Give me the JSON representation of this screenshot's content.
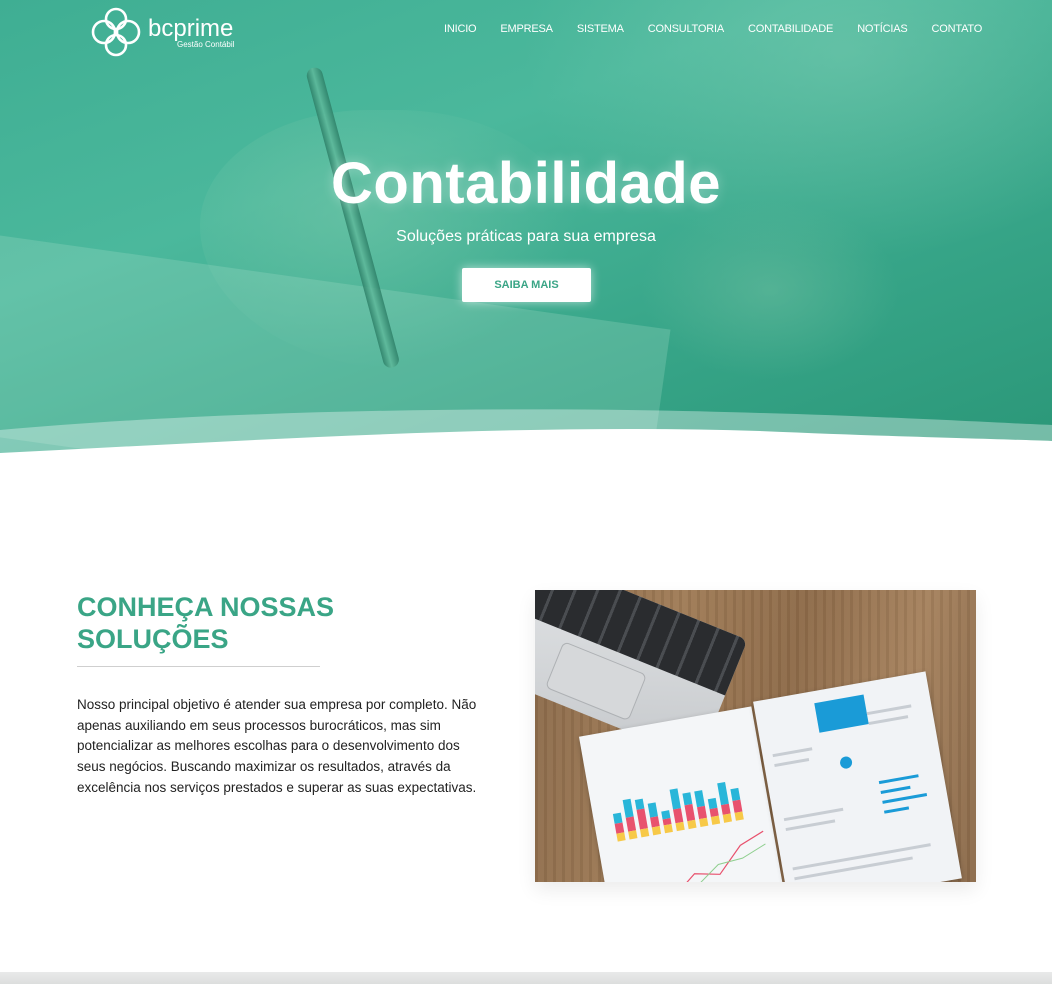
{
  "brand": {
    "name": "bcprime",
    "tagline": "Gestão Contábil"
  },
  "nav": {
    "items": [
      "INICIO",
      "EMPRESA",
      "SISTEMA",
      "CONSULTORIA",
      "CONTABILIDADE",
      "NOTÍCIAS",
      "CONTATO"
    ]
  },
  "hero": {
    "title": "Contabilidade",
    "subtitle": "Soluções práticas para sua empresa",
    "cta_label": "SAIBA MAIS"
  },
  "solutions": {
    "title_line1": "CONHEÇA NOSSAS",
    "title_line2": "SOLUÇÕES",
    "body": "Nosso principal objetivo é atender sua empresa por completo. Não apenas auxiliando em seus processos burocráticos, mas sim potencializar as melhores escolhas para o desenvolvimento dos seus negócios. Buscando maximizar os resultados, através da excelência nos serviços prestados e superar as suas expectativas."
  },
  "colors": {
    "accent": "#3aa586",
    "hero_green": "#4bb89c",
    "text": "#222222"
  }
}
